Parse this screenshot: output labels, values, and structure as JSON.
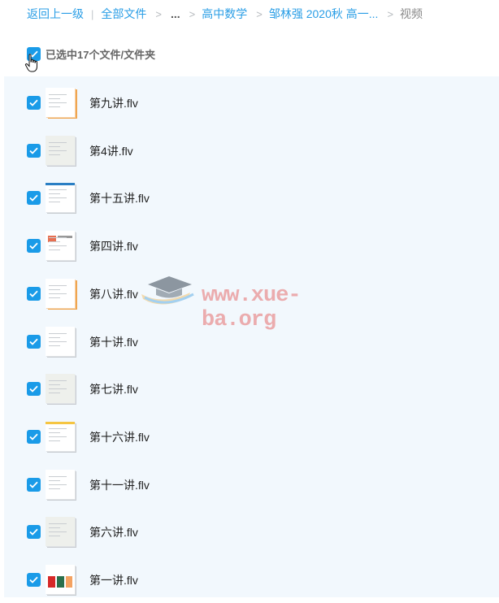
{
  "breadcrumb": {
    "back": "返回上一级",
    "all_files": "全部文件",
    "ellipsis": "...",
    "folder1": "高中数学",
    "folder2": "邹林强 2020秋 高一...",
    "current": "视频"
  },
  "selection": {
    "label": "已选中17个文件/文件夹",
    "checked": true
  },
  "files": [
    {
      "name": "第九讲.flv",
      "thumb": "orange"
    },
    {
      "name": "第4讲.flv",
      "thumb": "gray"
    },
    {
      "name": "第十五讲.flv",
      "thumb": "blue"
    },
    {
      "name": "第四讲.flv",
      "thumb": "photo"
    },
    {
      "name": "第八讲.flv",
      "thumb": "orange"
    },
    {
      "name": "第十讲.flv",
      "thumb": "plain"
    },
    {
      "name": "第七讲.flv",
      "thumb": "gray"
    },
    {
      "name": "第十六讲.flv",
      "thumb": "yellow"
    },
    {
      "name": "第十一讲.flv",
      "thumb": "plain"
    },
    {
      "name": "第六讲.flv",
      "thumb": "gray"
    },
    {
      "name": "第一讲.flv",
      "thumb": "colors"
    }
  ],
  "watermark": "www.xue-ba.org",
  "colors": {
    "accent": "#1a9be8",
    "list_bg": "#f2f8fd",
    "link": "#2a9ee6"
  }
}
